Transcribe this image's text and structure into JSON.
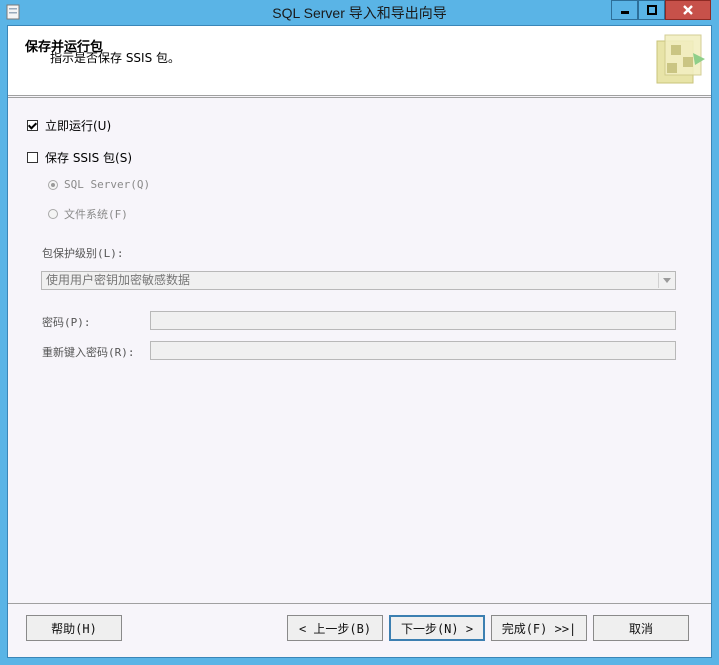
{
  "window": {
    "title": "SQL Server 导入和导出向导"
  },
  "header": {
    "title": "保存并运行包",
    "subtitle": "指示是否保存 SSIS 包。"
  },
  "options": {
    "run_now": {
      "label": "立即运行(U)",
      "checked": true
    },
    "save_ssis": {
      "label": "保存 SSIS 包(S)",
      "checked": false
    },
    "radio_sql": {
      "label": "SQL Server(Q)",
      "selected": true,
      "enabled": false
    },
    "radio_fs": {
      "label": "文件系统(F)",
      "selected": false,
      "enabled": false
    }
  },
  "protection": {
    "label": "包保护级别(L):",
    "value": "使用用户密钥加密敏感数据"
  },
  "password": {
    "label": "密码(P):",
    "value": ""
  },
  "retype_password": {
    "label": "重新键入密码(R):",
    "value": ""
  },
  "buttons": {
    "help": "帮助(H)",
    "back": "< 上一步(B)",
    "next": "下一步(N) >",
    "finish": "完成(F) >>|",
    "cancel": "取消"
  },
  "colors": {
    "titlebar": "#5ab4e6",
    "close_button": "#c7514a",
    "client_bg": "#f7f5fa"
  }
}
